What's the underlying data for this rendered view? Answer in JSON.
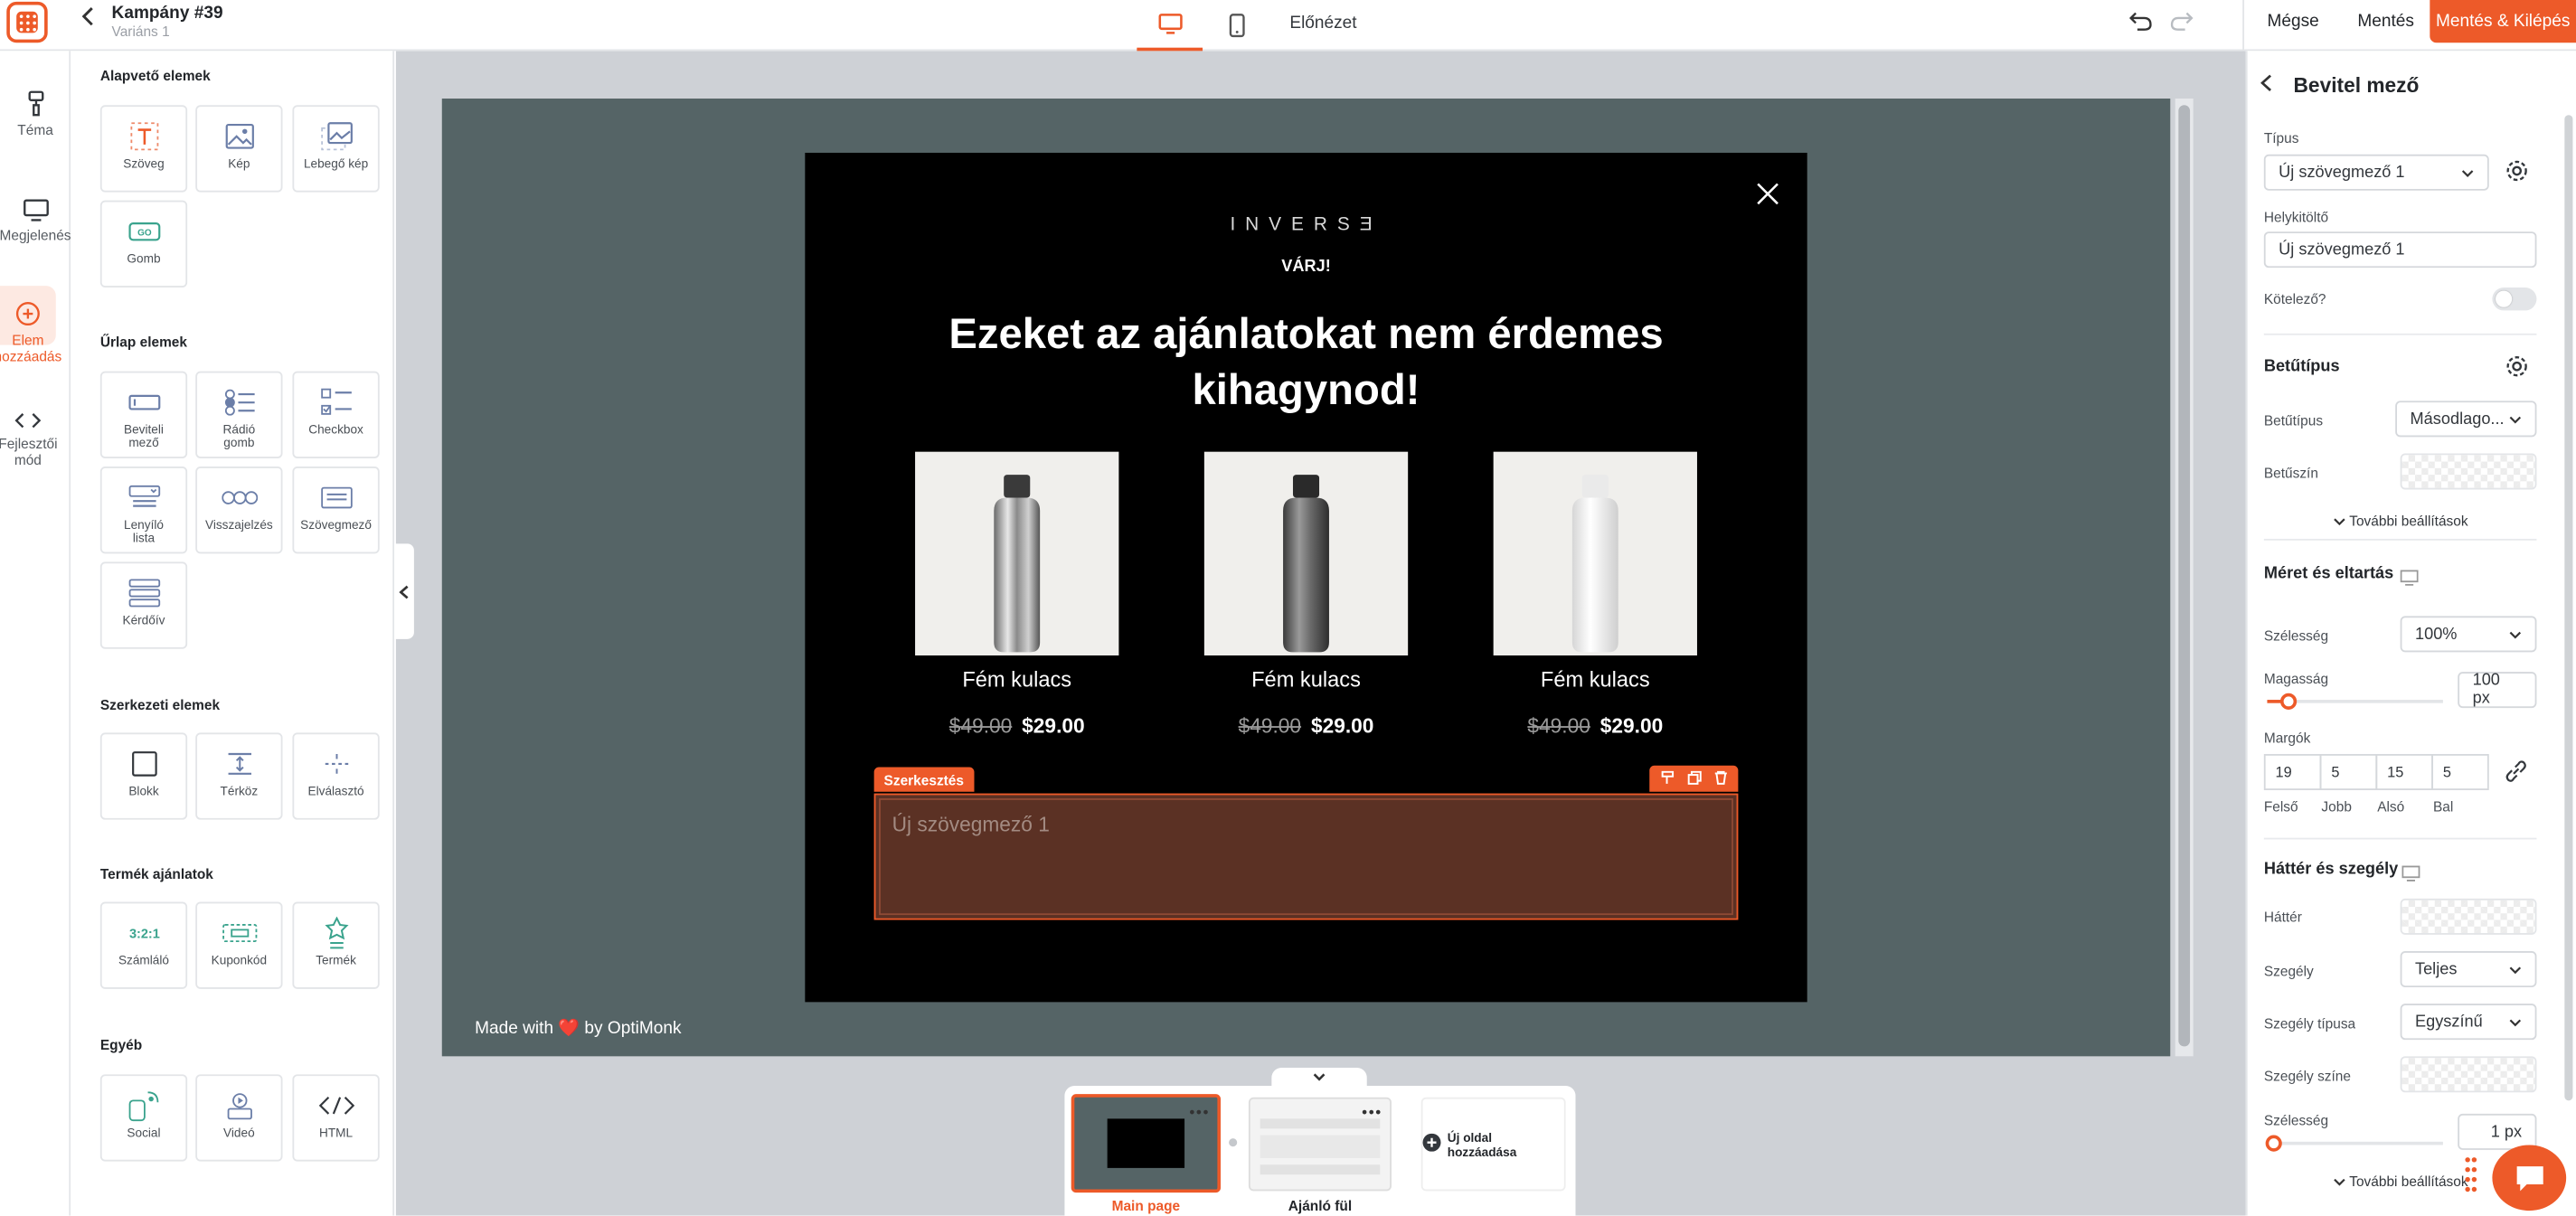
{
  "header": {
    "campaign_title": "Kampány #39",
    "variant": "Variáns 1",
    "preview_label": "Előnézet",
    "cancel_label": "Mégse",
    "save_label": "Mentés",
    "save_exit_label": "Mentés & Kilépés"
  },
  "leftnav": {
    "items": [
      {
        "label": "Téma",
        "icon": "paint-roller-icon"
      },
      {
        "label": "Megjelenés",
        "icon": "monitor-icon"
      },
      {
        "label": "Elem hozzáadás",
        "icon": "plus-circle-icon",
        "active": true
      },
      {
        "label": "Fejlesztői mód",
        "icon": "code-icon"
      }
    ]
  },
  "elements": {
    "basic_title": "Alapvető elemek",
    "basic": [
      "Szöveg",
      "Kép",
      "Lebegő kép",
      "Gomb"
    ],
    "form_title": "Űrlap elemek",
    "form": [
      "Beviteli mező",
      "Rádió gomb",
      "Checkbox",
      "Lenyíló lista",
      "Visszajelzés",
      "Szövegmező",
      "Kérdőív"
    ],
    "structure_title": "Szerkezeti elemek",
    "structure": [
      "Blokk",
      "Térköz",
      "Elválasztó"
    ],
    "product_title": "Termék ajánlatok",
    "product": [
      "Számláló",
      "Kuponkód",
      "Termék"
    ],
    "other_title": "Egyéb",
    "other": [
      "Social",
      "Videó",
      "HTML"
    ]
  },
  "popup": {
    "brand": "INVERSƎ",
    "kicker": "VÁRJ!",
    "headline": "Ezeket az ajánlatokat nem érdemes kihagynod!",
    "products": [
      {
        "name": "Fém kulacs",
        "old_price": "$49.00",
        "price": "$29.00",
        "color": "silver"
      },
      {
        "name": "Fém kulacs",
        "old_price": "$49.00",
        "price": "$29.00",
        "color": "gray"
      },
      {
        "name": "Fém kulacs",
        "old_price": "$49.00",
        "price": "$29.00",
        "color": "white"
      }
    ],
    "edit_tag": "Szerkesztés",
    "textarea_placeholder": "Új szövegmező 1",
    "made_with": "Made with ❤️ by OptiMonk"
  },
  "pages": {
    "items": [
      {
        "label": "Main page",
        "active": true
      },
      {
        "label": "Ajánló fül",
        "active": false
      }
    ],
    "add_label": "Új oldal hozzáadása"
  },
  "panel": {
    "title": "Bevitel mező",
    "type_label": "Típus",
    "type_value": "Új szövegmező 1",
    "placeholder_label": "Helykitöltő",
    "placeholder_value": "Új szövegmező 1",
    "required_label": "Kötelező?",
    "required": false,
    "font_section": "Betűtípus",
    "font_label": "Betűtípus",
    "font_value": "Másodlago...",
    "font_color_label": "Betűszín",
    "more_settings": "További beállítások",
    "size_section": "Méret és eltartás",
    "width_label": "Szélesség",
    "width_value": "100%",
    "height_label": "Magasság",
    "height_value": "100 px",
    "height_slider": 0.12,
    "margins_label": "Margók",
    "margins": [
      {
        "value": "19",
        "label": "Felső"
      },
      {
        "value": "5",
        "label": "Jobb"
      },
      {
        "value": "15",
        "label": "Alsó"
      },
      {
        "value": "5",
        "label": "Bal"
      }
    ],
    "bg_section": "Háttér és szegély",
    "bg_label": "Háttér",
    "border_label": "Szegély",
    "border_value": "Teljes",
    "border_type_label": "Szegély típusa",
    "border_type_value": "Egyszínű",
    "border_color_label": "Szegély színe",
    "border_width_label": "Szélesség",
    "border_width_value": "1 px",
    "more_settings_2": "További beállítások"
  },
  "colors": {
    "accent": "#ed5a29",
    "stage": "#556466",
    "popup_bg": "#000000",
    "textarea_bg": "#5b3124"
  }
}
